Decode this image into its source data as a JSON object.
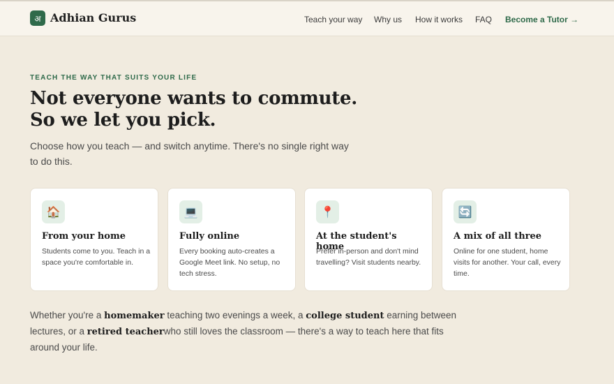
{
  "header": {
    "logo_glyph": "अ",
    "brand": "Adhian Gurus",
    "nav": [
      {
        "label": "Teach your way"
      },
      {
        "label": "Why us"
      },
      {
        "label": "How it works"
      },
      {
        "label": "FAQ"
      }
    ],
    "cta": "Become a Tutor →"
  },
  "hero": {
    "eyebrow": "TEACH THE WAY THAT SUITS YOUR LIFE",
    "title": "Not everyone wants to commute. So we let you pick.",
    "subtitle": "Choose how you teach — and switch anytime. There's no single right way to do this."
  },
  "cards": [
    {
      "icon": "house-icon",
      "glyph": "🏠",
      "title": "From your home",
      "text": "Students come to you. Teach in a space you're comfortable in."
    },
    {
      "icon": "laptop-icon",
      "glyph": "💻",
      "title": "Fully online",
      "text": "Every booking auto-creates a Google Meet link. No setup, no tech stress."
    },
    {
      "icon": "pin-icon",
      "glyph": "📍",
      "title": "At the student's home",
      "text": "Prefer in-person and don't mind travelling? Visit students nearby."
    },
    {
      "icon": "cycle-icon",
      "glyph": "🔄",
      "title": "A mix of all three",
      "text": "Online for one student, home visits for another. Your call, every time."
    }
  ],
  "bottom": {
    "t1": "Whether you're a ",
    "b1": "homemaker",
    "t2": " teaching two evenings a week, a ",
    "b2": "college student",
    "t3": " earning between lectures, or a ",
    "b3": "retired teacher",
    "t4": "who still loves the classroom — there's a way to teach here that fits around your life."
  },
  "colors": {
    "accent": "#2f6a4a",
    "background": "#f1ebdf",
    "card": "#ffffff",
    "icon_bg": "#e3efe6"
  }
}
